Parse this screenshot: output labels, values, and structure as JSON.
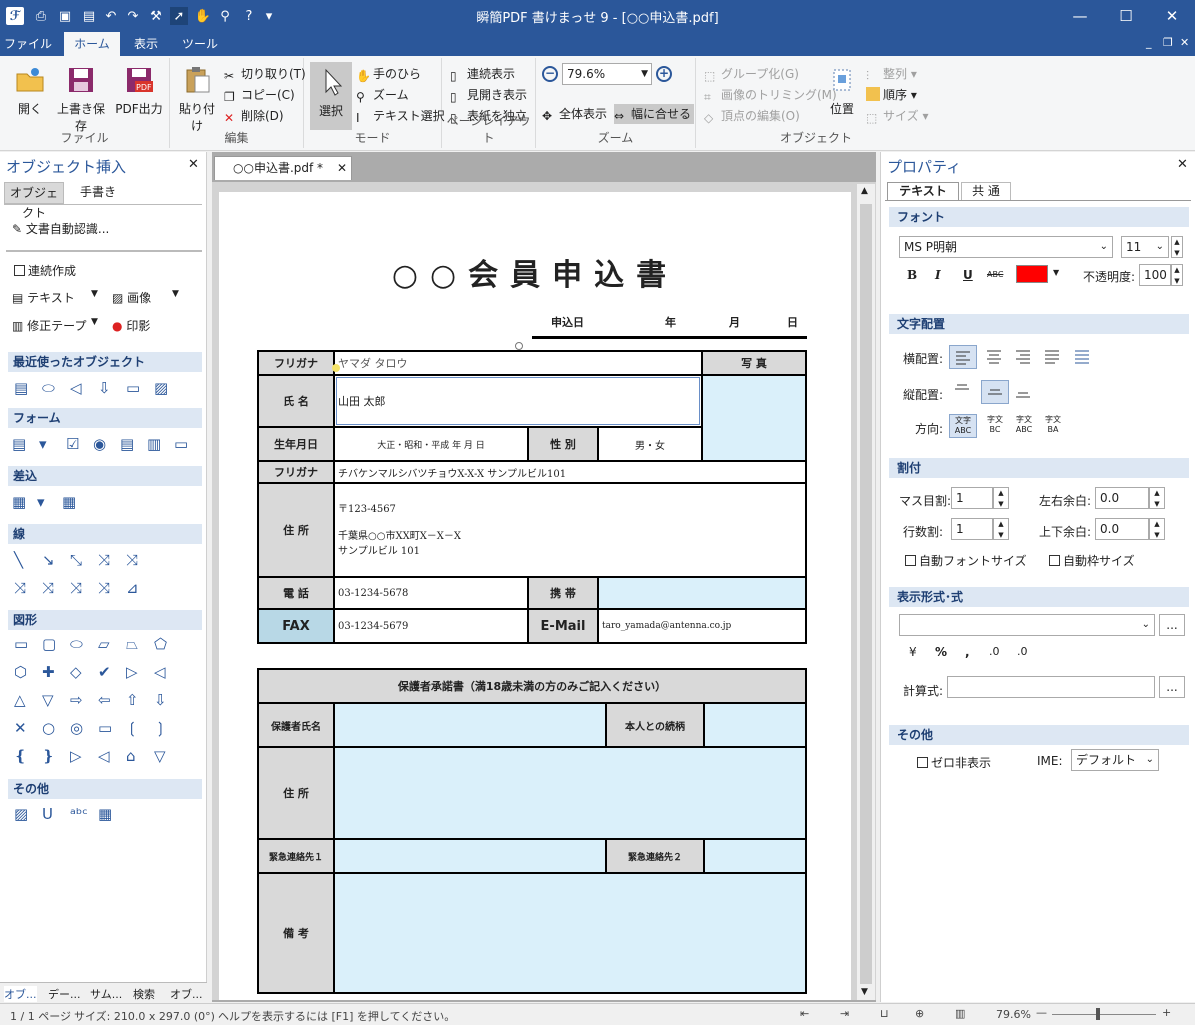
{
  "app": {
    "title": "瞬簡PDF 書けまっせ 9 - [○○申込書.pdf]"
  },
  "menu": {
    "items": [
      "ファイル",
      "ホーム",
      "表示",
      "ツール"
    ]
  },
  "ribbon": {
    "file": {
      "label": "ファイル",
      "open": "開く",
      "save": "上書き保存",
      "pdf": "PDF出力"
    },
    "edit": {
      "label": "編集",
      "paste": "貼り付け",
      "cut": "切り取り(T)",
      "copy": "コピー(C)",
      "delete": "削除(D)"
    },
    "mode": {
      "label": "モード",
      "select": "選択",
      "hand": "手のひら",
      "zoom": "ズーム",
      "textsel": "テキスト選択"
    },
    "pagelayout": {
      "label": "ページレイアウト",
      "continuous": "連続表示",
      "spread": "見開き表示",
      "cover": "表紙を独立"
    },
    "zoomgrp": {
      "label": "ズーム",
      "value": "79.6%",
      "fit_all": "全体表示",
      "fit_width": "幅に合せる"
    },
    "object": {
      "label": "オブジェクト",
      "group": "グループ化(G)",
      "trim": "画像のトリミング(M)",
      "vertex": "頂点の編集(O)",
      "position": "位置",
      "align": "整列",
      "order": "順序",
      "size": "サイズ"
    }
  },
  "left": {
    "title": "オブジェクト挿入",
    "tabs": [
      "オブジェクト",
      "手書き"
    ],
    "auto_recognize": "文書自動認識...",
    "continuous_create": "連続作成",
    "text": "テキスト",
    "image": "画像",
    "tape": "修正テープ",
    "stamp": "印影",
    "sections": [
      "最近使ったオブジェクト",
      "フォーム",
      "差込",
      "線",
      "図形",
      "その他"
    ],
    "bottom_tabs": [
      "オブ...",
      "デー...",
      "サム...",
      "検索",
      "オブ..."
    ]
  },
  "doc": {
    "tab": "○○申込書.pdf *"
  },
  "form": {
    "title": "○○会員申込書",
    "date_row": {
      "label": "申込日",
      "year": "年",
      "month": "月",
      "day": "日"
    },
    "furigana_label": "フリガナ",
    "furigana_value": "ヤマダ タロウ",
    "photo": "写 真",
    "name_label": "氏 名",
    "name_value": "山田 太郎",
    "birth_label": "生年月日",
    "birth_value": "大正・昭和・平成 年 月 日",
    "sex_label": "性 別",
    "sex_value": "男・女",
    "addr_furi_label": "フリガナ",
    "addr_furi_value": "チバケンマルシバツチョウX-X-X サンプルビル101",
    "addr_label": "住 所",
    "addr_zip": "〒123-4567",
    "addr_line1": "千葉県○○市XX町X－X－X",
    "addr_line2": "サンプルビル 101",
    "tel_label": "電 話",
    "tel_value": "03-1234-5678",
    "mobile_label": "携 帯",
    "fax_label": "FAX",
    "fax_value": "03-1234-5679",
    "email_label": "E-Mail",
    "email_value": "taro_yamada@antenna.co.jp",
    "guardian_title": "保護者承諾書（満18歳未満の方のみご記入ください）",
    "guardian_name": "保護者氏名",
    "relation": "本人との続柄",
    "guardian_addr": "住 所",
    "emergency1": "緊急連絡先１",
    "emergency2": "緊急連絡先２",
    "notes": "備 考"
  },
  "right": {
    "title": "プロパティ",
    "tabs": [
      "テキスト",
      "共 通"
    ],
    "font_section": "フォント",
    "font_name": "MS P明朝",
    "font_size": "11",
    "bold": "B",
    "italic": "I",
    "underline": "U",
    "strike": "ABC",
    "opacity_label": "不透明度:",
    "opacity_value": "100",
    "text_color": "#ff0000",
    "align_section": "文字配置",
    "halign_label": "横配置:",
    "valign_label": "縦配置:",
    "direction_label": "方向:",
    "split_section": "割付",
    "cell_label": "マス目割:",
    "cell_value": "1",
    "row_label": "行数割:",
    "row_value": "1",
    "lr_margin_label": "左右余白:",
    "lr_margin_value": "0.0",
    "tb_margin_label": "上下余白:",
    "tb_margin_value": "0.0",
    "auto_font": "自動フォントサイズ",
    "auto_frame": "自動枠サイズ",
    "format_section": "表示形式･式",
    "formula_label": "計算式:",
    "fmt_symbols": [
      "¥",
      "%",
      ",",
      ".0",
      ".0"
    ],
    "other_section": "その他",
    "zero_hide": "ゼロ非表示",
    "ime_label": "IME:",
    "ime_value": "デフォルト"
  },
  "status": {
    "page": "1 / 1 ページ",
    "size": "サイズ: 210.0 x 297.0 (0°)",
    "help": "ヘルプを表示するには [F1] を押してください。",
    "zoom": "79.6%"
  }
}
